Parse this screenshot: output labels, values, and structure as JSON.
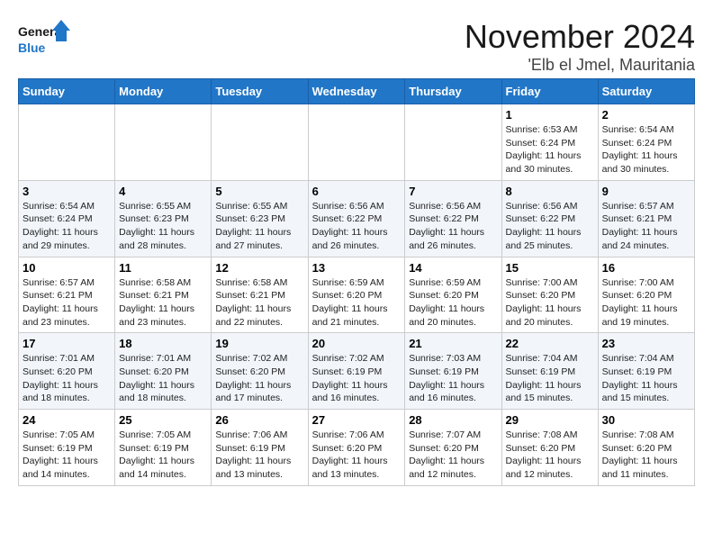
{
  "logo": {
    "line1": "General",
    "line2": "Blue"
  },
  "title": "November 2024",
  "subtitle": "'Elb el Jmel, Mauritania",
  "days_of_week": [
    "Sunday",
    "Monday",
    "Tuesday",
    "Wednesday",
    "Thursday",
    "Friday",
    "Saturday"
  ],
  "weeks": [
    [
      {
        "day": "",
        "info": ""
      },
      {
        "day": "",
        "info": ""
      },
      {
        "day": "",
        "info": ""
      },
      {
        "day": "",
        "info": ""
      },
      {
        "day": "",
        "info": ""
      },
      {
        "day": "1",
        "info": "Sunrise: 6:53 AM\nSunset: 6:24 PM\nDaylight: 11 hours and 30 minutes."
      },
      {
        "day": "2",
        "info": "Sunrise: 6:54 AM\nSunset: 6:24 PM\nDaylight: 11 hours and 30 minutes."
      }
    ],
    [
      {
        "day": "3",
        "info": "Sunrise: 6:54 AM\nSunset: 6:24 PM\nDaylight: 11 hours and 29 minutes."
      },
      {
        "day": "4",
        "info": "Sunrise: 6:55 AM\nSunset: 6:23 PM\nDaylight: 11 hours and 28 minutes."
      },
      {
        "day": "5",
        "info": "Sunrise: 6:55 AM\nSunset: 6:23 PM\nDaylight: 11 hours and 27 minutes."
      },
      {
        "day": "6",
        "info": "Sunrise: 6:56 AM\nSunset: 6:22 PM\nDaylight: 11 hours and 26 minutes."
      },
      {
        "day": "7",
        "info": "Sunrise: 6:56 AM\nSunset: 6:22 PM\nDaylight: 11 hours and 26 minutes."
      },
      {
        "day": "8",
        "info": "Sunrise: 6:56 AM\nSunset: 6:22 PM\nDaylight: 11 hours and 25 minutes."
      },
      {
        "day": "9",
        "info": "Sunrise: 6:57 AM\nSunset: 6:21 PM\nDaylight: 11 hours and 24 minutes."
      }
    ],
    [
      {
        "day": "10",
        "info": "Sunrise: 6:57 AM\nSunset: 6:21 PM\nDaylight: 11 hours and 23 minutes."
      },
      {
        "day": "11",
        "info": "Sunrise: 6:58 AM\nSunset: 6:21 PM\nDaylight: 11 hours and 23 minutes."
      },
      {
        "day": "12",
        "info": "Sunrise: 6:58 AM\nSunset: 6:21 PM\nDaylight: 11 hours and 22 minutes."
      },
      {
        "day": "13",
        "info": "Sunrise: 6:59 AM\nSunset: 6:20 PM\nDaylight: 11 hours and 21 minutes."
      },
      {
        "day": "14",
        "info": "Sunrise: 6:59 AM\nSunset: 6:20 PM\nDaylight: 11 hours and 20 minutes."
      },
      {
        "day": "15",
        "info": "Sunrise: 7:00 AM\nSunset: 6:20 PM\nDaylight: 11 hours and 20 minutes."
      },
      {
        "day": "16",
        "info": "Sunrise: 7:00 AM\nSunset: 6:20 PM\nDaylight: 11 hours and 19 minutes."
      }
    ],
    [
      {
        "day": "17",
        "info": "Sunrise: 7:01 AM\nSunset: 6:20 PM\nDaylight: 11 hours and 18 minutes."
      },
      {
        "day": "18",
        "info": "Sunrise: 7:01 AM\nSunset: 6:20 PM\nDaylight: 11 hours and 18 minutes."
      },
      {
        "day": "19",
        "info": "Sunrise: 7:02 AM\nSunset: 6:20 PM\nDaylight: 11 hours and 17 minutes."
      },
      {
        "day": "20",
        "info": "Sunrise: 7:02 AM\nSunset: 6:19 PM\nDaylight: 11 hours and 16 minutes."
      },
      {
        "day": "21",
        "info": "Sunrise: 7:03 AM\nSunset: 6:19 PM\nDaylight: 11 hours and 16 minutes."
      },
      {
        "day": "22",
        "info": "Sunrise: 7:04 AM\nSunset: 6:19 PM\nDaylight: 11 hours and 15 minutes."
      },
      {
        "day": "23",
        "info": "Sunrise: 7:04 AM\nSunset: 6:19 PM\nDaylight: 11 hours and 15 minutes."
      }
    ],
    [
      {
        "day": "24",
        "info": "Sunrise: 7:05 AM\nSunset: 6:19 PM\nDaylight: 11 hours and 14 minutes."
      },
      {
        "day": "25",
        "info": "Sunrise: 7:05 AM\nSunset: 6:19 PM\nDaylight: 11 hours and 14 minutes."
      },
      {
        "day": "26",
        "info": "Sunrise: 7:06 AM\nSunset: 6:19 PM\nDaylight: 11 hours and 13 minutes."
      },
      {
        "day": "27",
        "info": "Sunrise: 7:06 AM\nSunset: 6:20 PM\nDaylight: 11 hours and 13 minutes."
      },
      {
        "day": "28",
        "info": "Sunrise: 7:07 AM\nSunset: 6:20 PM\nDaylight: 11 hours and 12 minutes."
      },
      {
        "day": "29",
        "info": "Sunrise: 7:08 AM\nSunset: 6:20 PM\nDaylight: 11 hours and 12 minutes."
      },
      {
        "day": "30",
        "info": "Sunrise: 7:08 AM\nSunset: 6:20 PM\nDaylight: 11 hours and 11 minutes."
      }
    ]
  ]
}
